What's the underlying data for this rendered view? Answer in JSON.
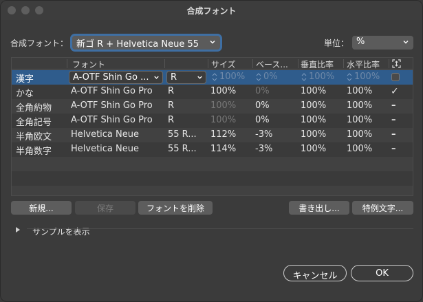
{
  "window": {
    "title": "合成フォント"
  },
  "composite": {
    "label": "合成フォント：",
    "value": "新ゴ R + Helvetica Neue 55"
  },
  "unit": {
    "label": "単位：",
    "value": "%"
  },
  "table": {
    "headers": [
      "フォント",
      "",
      "サイズ",
      "ベース...",
      "垂直比率",
      "水平比率"
    ],
    "rows": [
      {
        "name": "漢字",
        "font": "A-OTF Shin Go ...",
        "style": "R",
        "size": "100%",
        "baseline": "0%",
        "vscale": "100%",
        "hscale": "100%",
        "check": "box",
        "selected": true
      },
      {
        "name": "かな",
        "font": "A-OTF Shin Go Pro",
        "style": "R",
        "size": "100%",
        "baseline": "0%",
        "vscale": "100%",
        "hscale": "100%",
        "check": "✓"
      },
      {
        "name": "全角約物",
        "font": "A-OTF Shin Go Pro",
        "style": "R",
        "size": "100%",
        "baseline": "0%",
        "vscale": "100%",
        "hscale": "100%",
        "check": "–"
      },
      {
        "name": "全角記号",
        "font": "A-OTF Shin Go Pro",
        "style": "R",
        "size": "100%",
        "baseline": "0%",
        "vscale": "100%",
        "hscale": "100%",
        "check": "–"
      },
      {
        "name": "半角欧文",
        "font": "Helvetica Neue",
        "style": "55 R...",
        "size": "112%",
        "baseline": "-3%",
        "vscale": "100%",
        "hscale": "100%",
        "check": "–"
      },
      {
        "name": "半角数字",
        "font": "Helvetica Neue",
        "style": "55 R...",
        "size": "114%",
        "baseline": "-3%",
        "vscale": "100%",
        "hscale": "100%",
        "check": "–"
      }
    ]
  },
  "buttons": {
    "new": "新規...",
    "save": "保存",
    "delete_font": "フォントを削除",
    "export": "書き出し...",
    "special_chars": "特例文字...",
    "cancel": "キャンセル",
    "ok": "OK"
  },
  "sample": {
    "label": "サンプルを表示"
  },
  "colors": {
    "accent": "#3f6fa3",
    "selection": "#2f5c8c",
    "background": "#3b3b3b"
  },
  "icons": {
    "chevron": "chevron-down-icon",
    "fit": "fit-height-icon",
    "disclosure": "disclosure-triangle-icon"
  }
}
